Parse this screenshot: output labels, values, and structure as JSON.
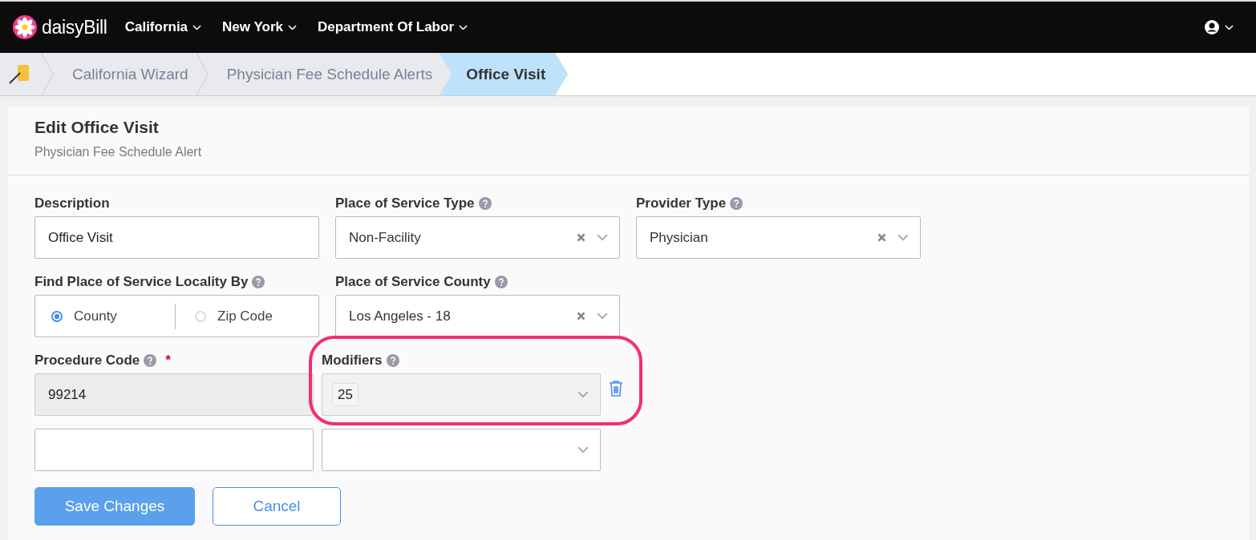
{
  "nav": {
    "logo": "daisyBill",
    "menus": [
      "California",
      "New York",
      "Department Of Labor"
    ]
  },
  "breadcrumbs": [
    {
      "label": "California Wizard",
      "selected": false
    },
    {
      "label": "Physician Fee Schedule Alerts",
      "selected": false
    },
    {
      "label": "Office Visit",
      "selected": true
    }
  ],
  "form": {
    "title": "Edit Office Visit",
    "subtitle": "Physician Fee Schedule Alert",
    "rows": [
      [
        {
          "kind": "text",
          "label": "Description",
          "help": false,
          "value": "Office Visit"
        },
        {
          "kind": "select",
          "label": "Place of Service Type",
          "help": true,
          "value": "Non-Facility",
          "clearable": true
        },
        {
          "kind": "select",
          "label": "Provider Type",
          "help": true,
          "value": "Physician",
          "clearable": true
        }
      ],
      [
        {
          "kind": "radio",
          "label": "Find Place of Service Locality By",
          "help": true,
          "options": [
            {
              "label": "County",
              "selected": true
            },
            {
              "label": "Zip Code",
              "selected": false
            }
          ]
        },
        {
          "kind": "select",
          "label": "Place of Service County",
          "help": true,
          "value": "Los Angeles - 18",
          "clearable": true
        }
      ]
    ],
    "procedure_label": "Procedure Code",
    "procedure_help": true,
    "procedure_required_mark": "*",
    "modifiers_label": "Modifiers",
    "modifiers_help": true,
    "code_rows": [
      {
        "procedure_code": "99214",
        "disabled": true,
        "modifiers": [
          "25"
        ],
        "removable": true,
        "highlighted": true
      },
      {
        "disabled": false,
        "modifiers": [],
        "removable": false,
        "highlighted": false
      }
    ],
    "buttons": [
      {
        "label": "Save Changes",
        "kind": "primary"
      },
      {
        "label": "Cancel",
        "kind": "secondary"
      }
    ]
  }
}
